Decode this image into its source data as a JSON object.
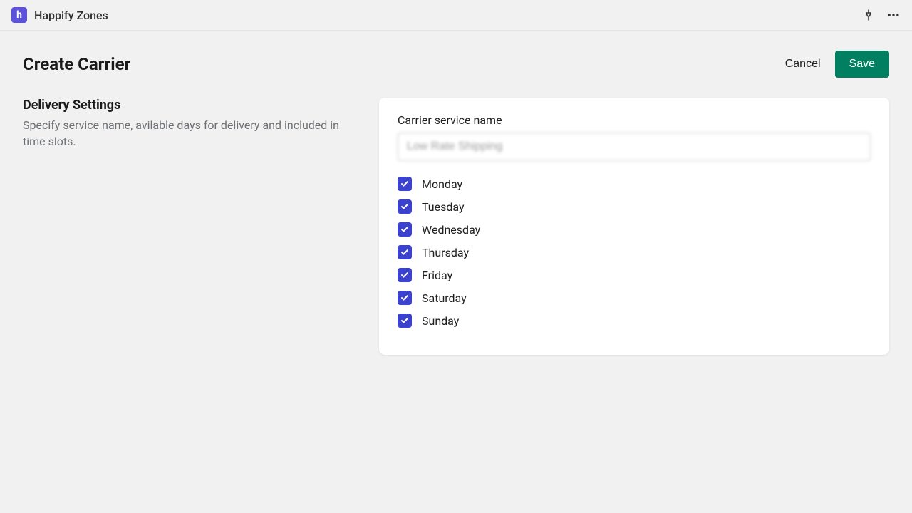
{
  "app": {
    "name": "Happify Zones",
    "icon_letter": "h"
  },
  "header": {
    "title": "Create Carrier",
    "cancel_label": "Cancel",
    "save_label": "Save"
  },
  "section": {
    "title": "Delivery Settings",
    "description": "Specify service name, avilable days for delivery and included in time slots."
  },
  "form": {
    "carrier_label": "Carrier service name",
    "carrier_value": "Low Rate Shipping",
    "days": [
      {
        "label": "Monday",
        "checked": true
      },
      {
        "label": "Tuesday",
        "checked": true
      },
      {
        "label": "Wednesday",
        "checked": true
      },
      {
        "label": "Thursday",
        "checked": true
      },
      {
        "label": "Friday",
        "checked": true
      },
      {
        "label": "Saturday",
        "checked": true
      },
      {
        "label": "Sunday",
        "checked": true
      }
    ]
  }
}
